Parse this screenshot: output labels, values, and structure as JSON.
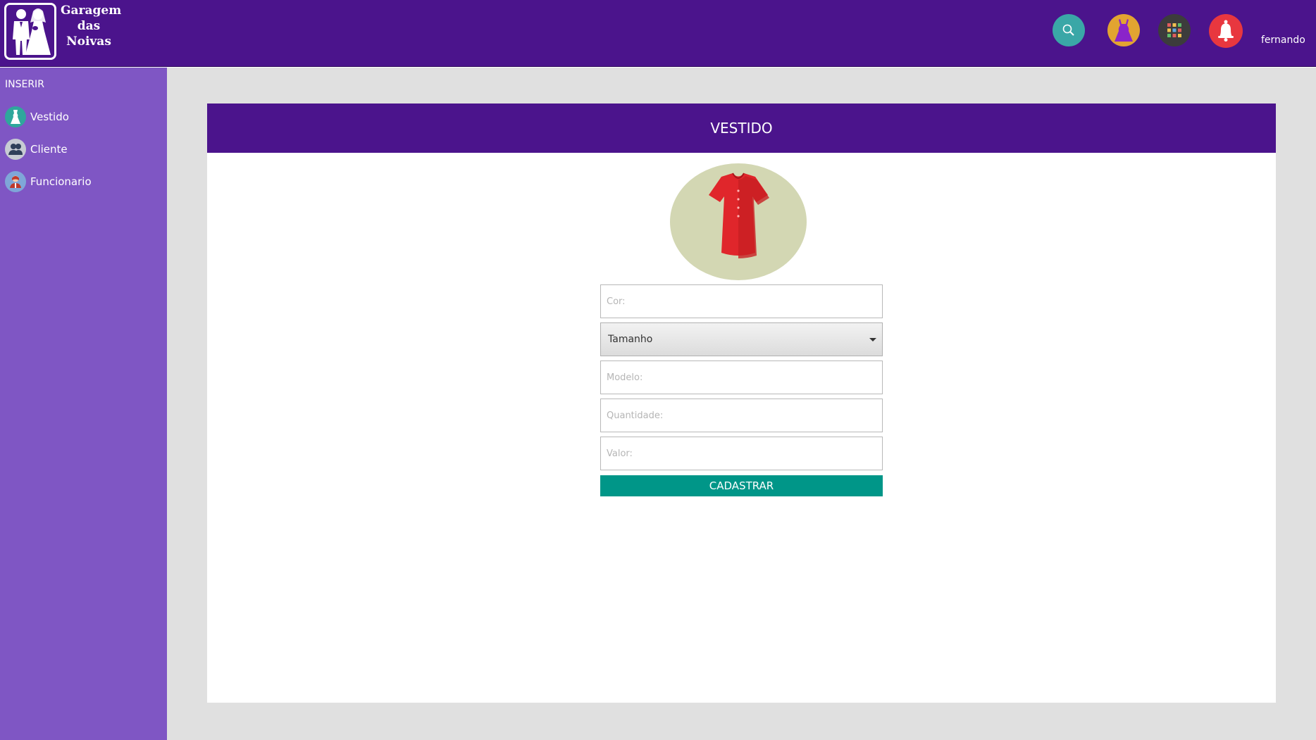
{
  "brand": {
    "logo_text": "Garagem\ndas\nNoivas"
  },
  "header": {
    "username": "fernando",
    "icons": [
      "search-icon",
      "dress-icon",
      "apps-grid-icon",
      "bell-icon"
    ]
  },
  "sidebar": {
    "heading": "INSERIR",
    "items": [
      {
        "label": "Vestido",
        "icon": "dress-icon"
      },
      {
        "label": "Cliente",
        "icon": "users-icon"
      },
      {
        "label": "Funcionario",
        "icon": "employee-icon"
      }
    ]
  },
  "form": {
    "title": "VESTIDO",
    "fields": {
      "cor_placeholder": "Cor:",
      "tamanho_selected": "Tamanho",
      "modelo_placeholder": "Modelo:",
      "quantidade_placeholder": "Quantidade:",
      "valor_placeholder": "Valor:"
    },
    "submit_label": "CADASTRAR"
  },
  "colors": {
    "header": "#4b148c",
    "sidebar": "#7f56c4",
    "submit": "#009688",
    "background": "#e0e0e0"
  }
}
